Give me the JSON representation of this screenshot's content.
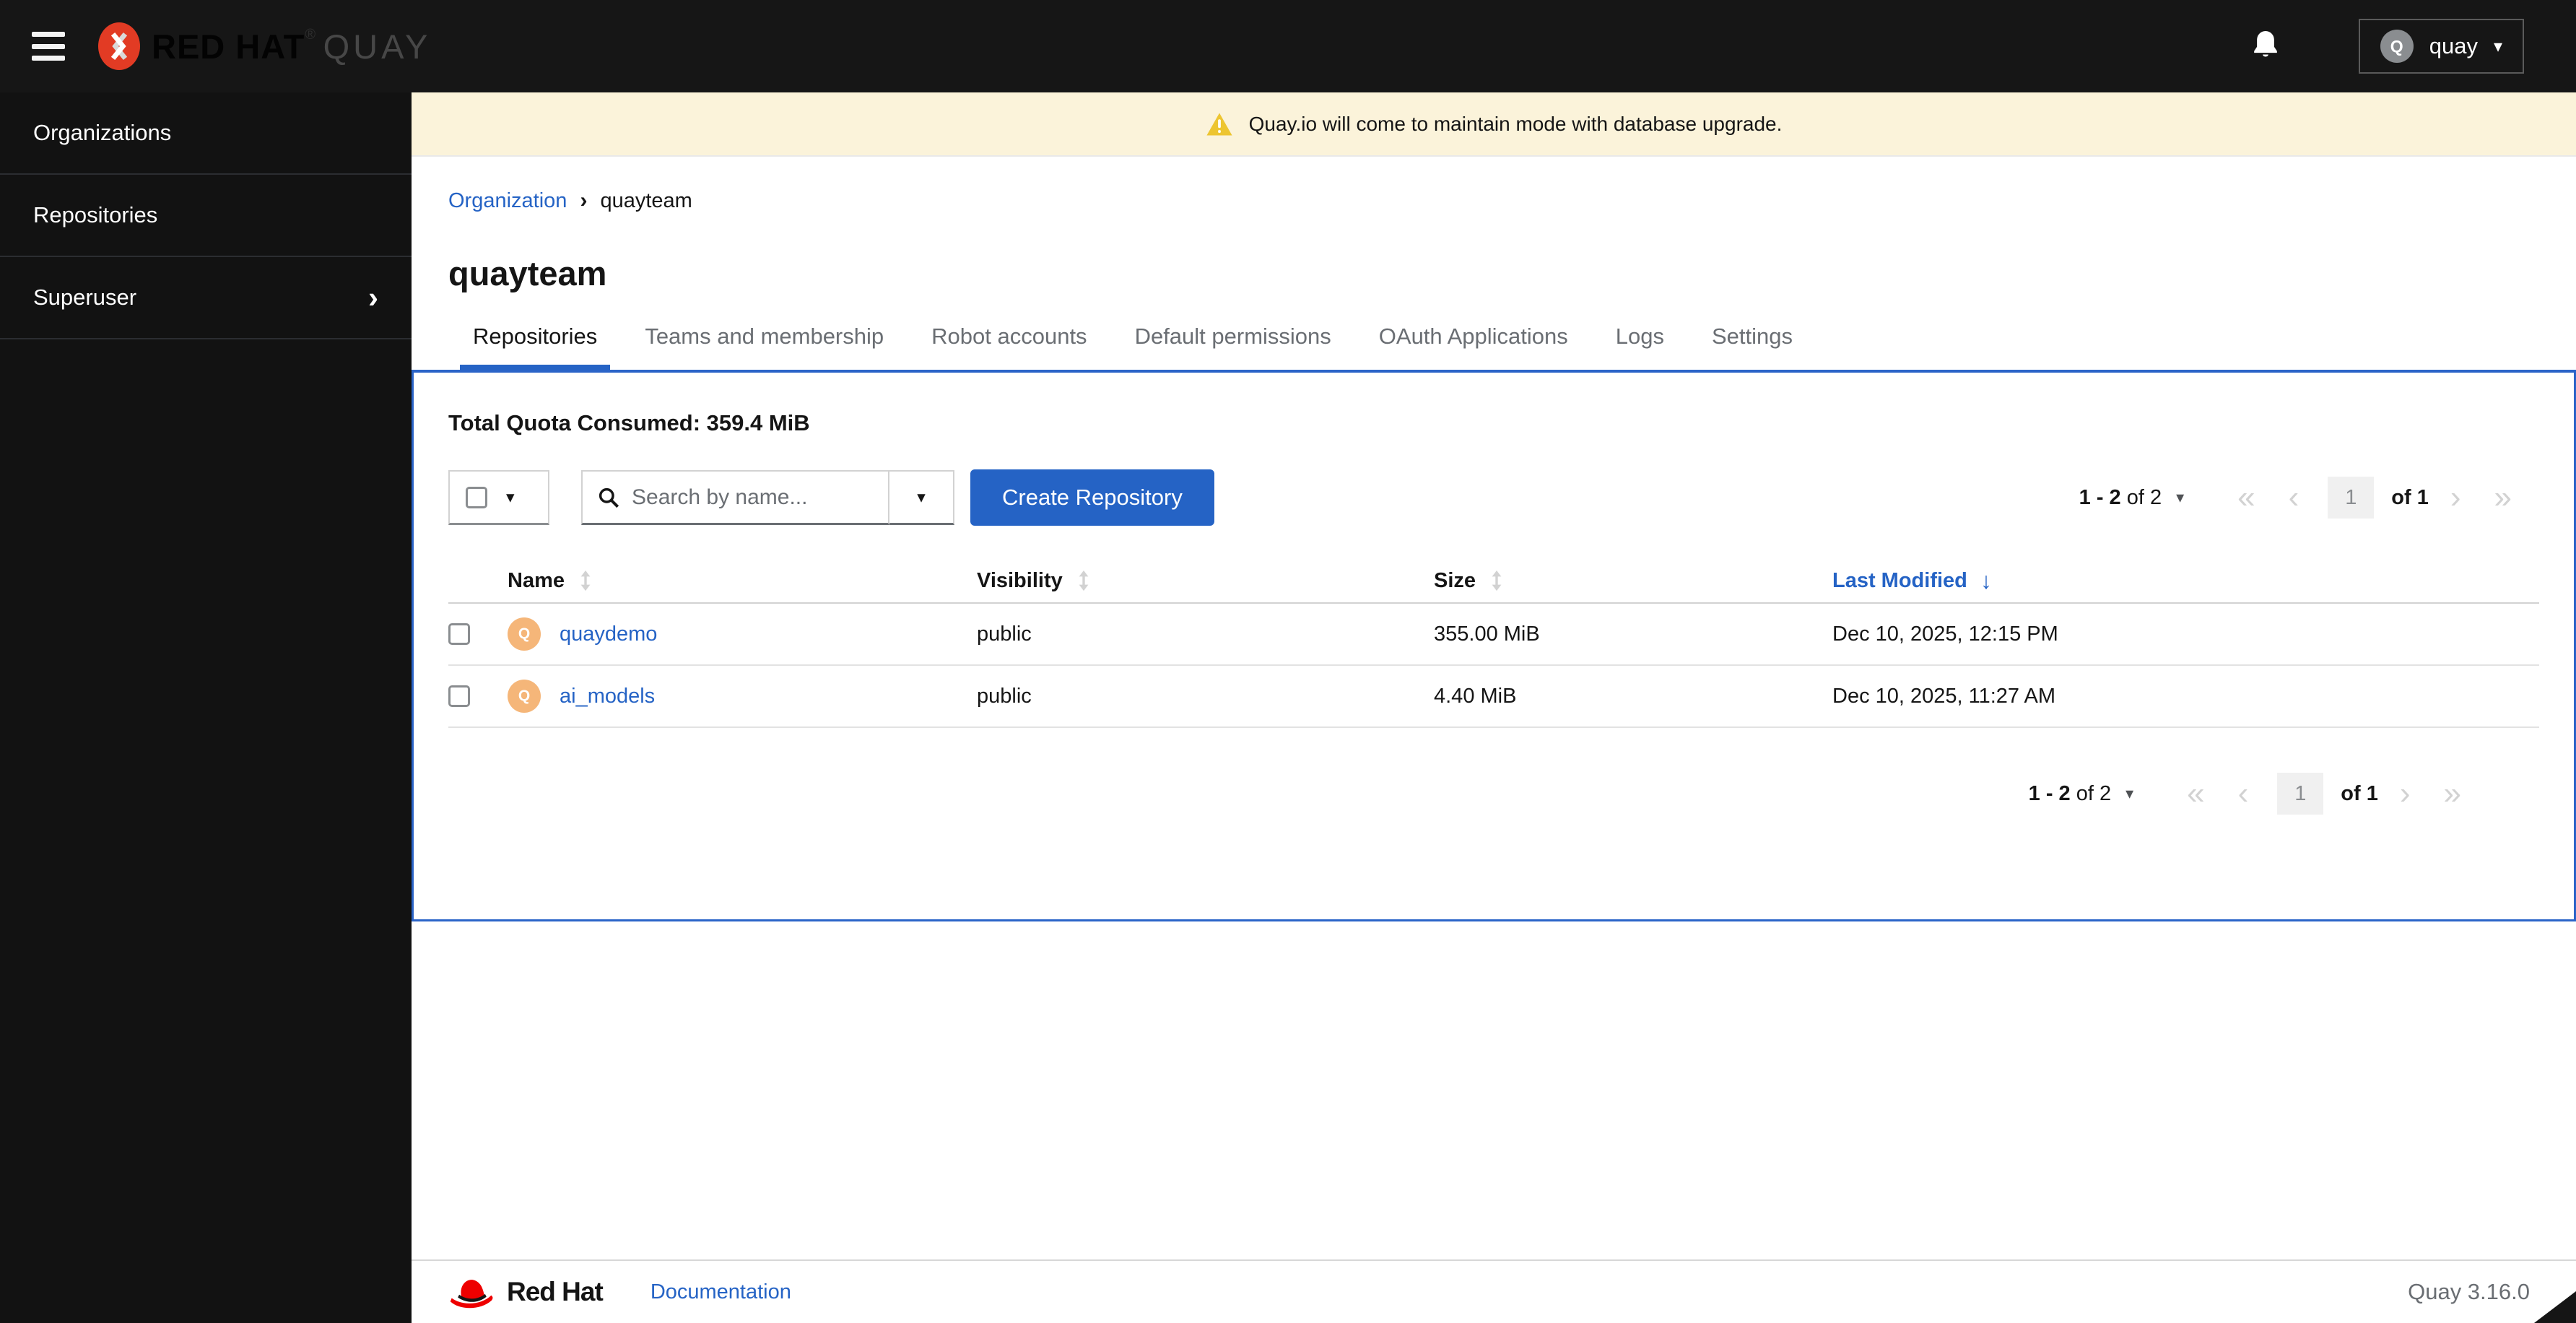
{
  "header": {
    "brand": "RED HAT",
    "registered": "®",
    "product": "QUAY",
    "user": {
      "name": "quay",
      "avatar_initial": "Q"
    }
  },
  "sidebar": {
    "items": [
      {
        "label": "Organizations"
      },
      {
        "label": "Repositories"
      },
      {
        "label": "Superuser"
      }
    ]
  },
  "banner": {
    "message": "Quay.io will come to maintain mode with database upgrade."
  },
  "breadcrumb": {
    "parent": "Organization",
    "current": "quayteam"
  },
  "page": {
    "title": "quayteam"
  },
  "tabs": [
    {
      "label": "Repositories"
    },
    {
      "label": "Teams and membership"
    },
    {
      "label": "Robot accounts"
    },
    {
      "label": "Default permissions"
    },
    {
      "label": "OAuth Applications"
    },
    {
      "label": "Logs"
    },
    {
      "label": "Settings"
    }
  ],
  "panel": {
    "quota": "Total Quota Consumed: 359.4 MiB",
    "toolbar": {
      "search_placeholder": "Search by name...",
      "create_button": "Create Repository"
    },
    "pagination": {
      "range_strong": "1 - 2",
      "range_suffix": " of 2",
      "page_value": "1",
      "page_of": "of 1",
      "first": "«",
      "prev": "‹",
      "next": "›",
      "last": "»"
    },
    "table": {
      "columns": {
        "name": "Name",
        "visibility": "Visibility",
        "size": "Size",
        "last_modified": "Last Modified"
      },
      "sort_arrow_down": "↓",
      "rows": [
        {
          "avatar_initial": "Q",
          "name": "quaydemo",
          "visibility": "public",
          "size": "355.00 MiB",
          "last_modified": "Dec 10, 2025, 12:15 PM"
        },
        {
          "avatar_initial": "Q",
          "name": "ai_models",
          "visibility": "public",
          "size": "4.40 MiB",
          "last_modified": "Dec 10, 2025, 11:27 AM"
        }
      ]
    }
  },
  "footer": {
    "brand": "Red Hat",
    "documentation": "Documentation",
    "version": "Quay 3.16.0"
  },
  "colors": {
    "accent_blue": "#2563c5",
    "header_bg": "#161616",
    "banner_bg": "#fbf3da",
    "warning_gold": "#edc531",
    "avatar_orange": "#f5b679",
    "muted_gray": "#6a6e73"
  }
}
